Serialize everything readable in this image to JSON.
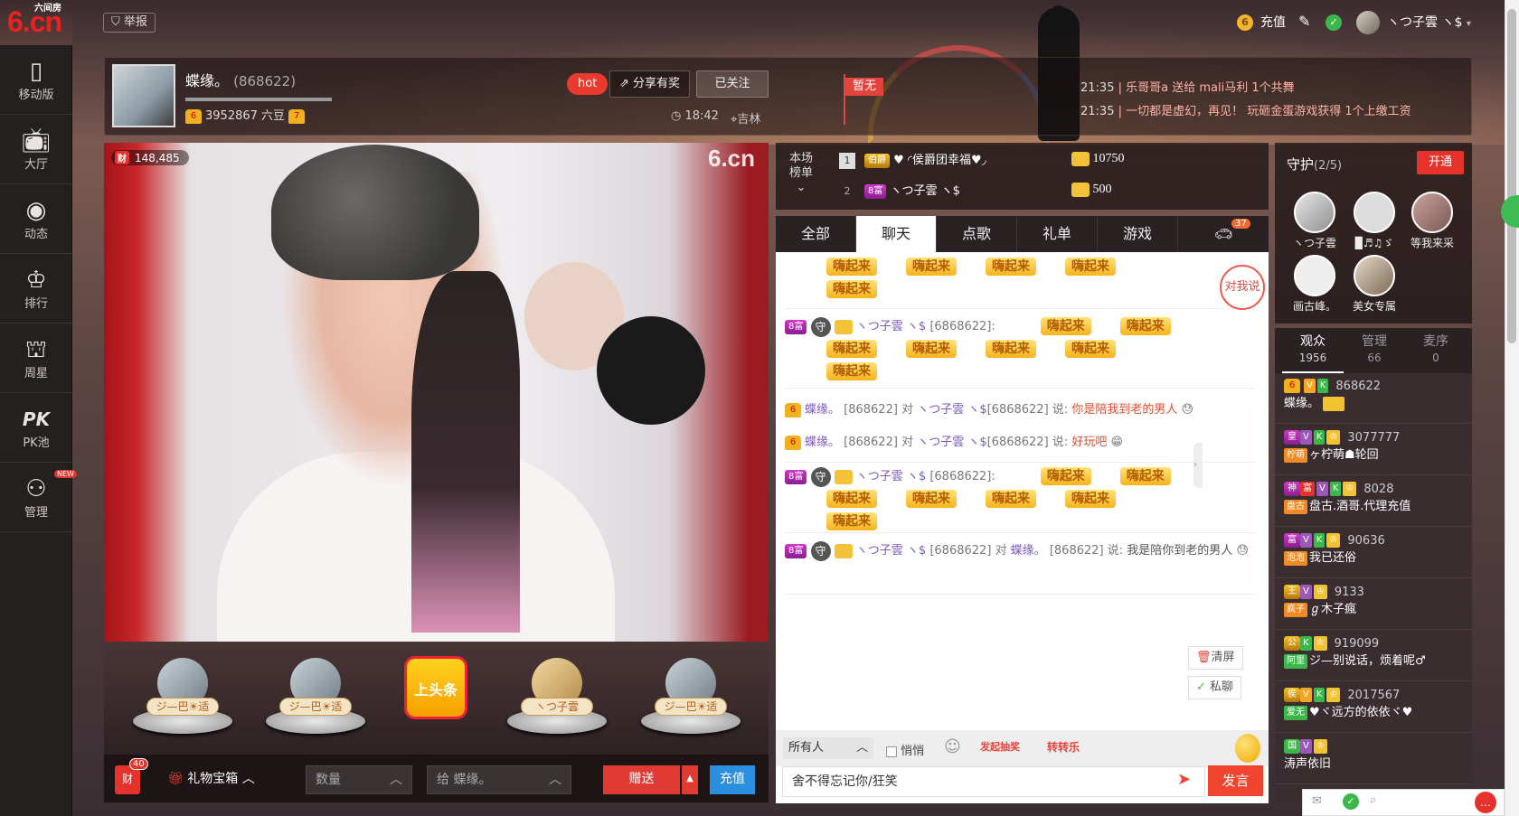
{
  "header": {
    "logo_text": "6.cn",
    "logo_sub": "六间房",
    "report_label": "举报",
    "recharge_label": "充值",
    "username": "ヽつ子雲 ヽ$"
  },
  "sidebar": {
    "items": [
      {
        "label": "移动版",
        "icon": "mobile-icon"
      },
      {
        "label": "大厅",
        "icon": "tv-icon"
      },
      {
        "label": "动态",
        "icon": "compass-icon"
      },
      {
        "label": "排行",
        "icon": "crown-icon"
      },
      {
        "label": "周星",
        "icon": "basket-icon"
      },
      {
        "label": "PK池",
        "icon": "pk-icon",
        "glyph": "PK"
      },
      {
        "label": "管理",
        "icon": "admin-icon",
        "badge": "NEW"
      }
    ]
  },
  "anchor": {
    "name": "蝶缘。",
    "id": "(868622)",
    "beans": "3952867 六豆",
    "hot": "hot",
    "share": "分享有奖",
    "follow": "已关注",
    "time": "18:42",
    "location": "吉林",
    "flag": "暂无",
    "level_left": "6",
    "level_right": "7"
  },
  "news": [
    {
      "time": "21:35",
      "text": "乐哥哥a 送给 mali马利 1个共舞"
    },
    {
      "time": "21:35",
      "text": "一切都是虚幻，再见！ 玩砸金蛋游戏获得 1个上缴工资"
    }
  ],
  "video": {
    "viewers_badge": "财",
    "viewers": "148,485",
    "watermark": "6.cn"
  },
  "seats": [
    {
      "name": "ジ—巴☀适"
    },
    {
      "name": "ジ—巴☀适"
    },
    {
      "name": "上头条",
      "headline": true
    },
    {
      "name": "ヽつ子雲"
    },
    {
      "name": "ジ—巴☀适"
    }
  ],
  "giftbar": {
    "badge": "40",
    "badge_icon": "财",
    "giftbox": "礼物宝箱",
    "qty_placeholder": "数量",
    "to": "给 蝶缘。",
    "send": "赠送",
    "recharge": "充值"
  },
  "rank": {
    "title": "本场榜单",
    "rows": [
      {
        "n": "1",
        "level": "伯爵",
        "name": "♥ ◜侯爵团幸福♥◞",
        "score": "10750"
      },
      {
        "n": "2",
        "level": "8富",
        "name": "ヽつ子雲 ヽ$",
        "score": "500"
      }
    ]
  },
  "tabs": [
    {
      "label": "全部"
    },
    {
      "label": "聊天",
      "active": true
    },
    {
      "label": "点歌"
    },
    {
      "label": "礼单"
    },
    {
      "label": "游戏"
    },
    {
      "label": "car-icon",
      "badge": "37"
    }
  ],
  "chat": {
    "hi_text": "嗨起来",
    "to_me": "对我说",
    "user": "ヽつ子雲 ヽ$",
    "user_id": "[6868622]:",
    "anchor": "蝶缘。",
    "m1_prefix": "[868622] 对",
    "m1_target": "ヽつ子雲 ヽ$",
    "m1_tid": "[6868622] 说:",
    "m1_said": "你是陪我到老的男人",
    "m2_said": "好玩吧",
    "m3_pre": "[6868622] 对",
    "m3_tid": "[868622] 说:",
    "m3_said": "我是陪你到老的男人",
    "clear": "清屏",
    "private": "私聊"
  },
  "input": {
    "to": "所有人",
    "whisper": "悄悄",
    "lottery": "发起抽奖",
    "wheel": "转转乐",
    "text": "舍不得忘记你/狂笑",
    "send": "发言"
  },
  "guard": {
    "title": "守护",
    "count": "(2/5)",
    "open": "开通",
    "members": [
      {
        "name": "ヽつ子雲"
      },
      {
        "name": "▉♬♫ゞ"
      },
      {
        "name": "等我来采"
      },
      {
        "name": "画古峰。"
      },
      {
        "name": "美女专属"
      }
    ]
  },
  "audience_tabs": [
    {
      "label": "观众",
      "count": "1956",
      "active": true
    },
    {
      "label": "管理",
      "count": "66"
    },
    {
      "label": "麦序",
      "count": "0"
    }
  ],
  "users": [
    {
      "id": "868622",
      "name": "蝶缘。"
    },
    {
      "id": "3077777",
      "name": "ヶ柠萌☗轮回",
      "tag": "柠萌"
    },
    {
      "id": "8028",
      "name": "盘古.酒哥.代理充值",
      "tag": "盘古"
    },
    {
      "id": "90636",
      "name": "我已还俗",
      "tag": "泡泡"
    },
    {
      "id": "9133",
      "name": "ℊ木子瘋",
      "tag": "疯子"
    },
    {
      "id": "919099",
      "name": "ジ—别说话，烦着呢♂",
      "tag": "阿里"
    },
    {
      "id": "2017567",
      "name": "♥ヾ远方的依依ヾ♥",
      "tag": "爱无"
    },
    {
      "id": "",
      "name": "涛声依旧",
      "tag": ""
    }
  ],
  "colors": {
    "accent": "#e5322c",
    "send": "#f0442f",
    "blue": "#2b8fe0"
  }
}
